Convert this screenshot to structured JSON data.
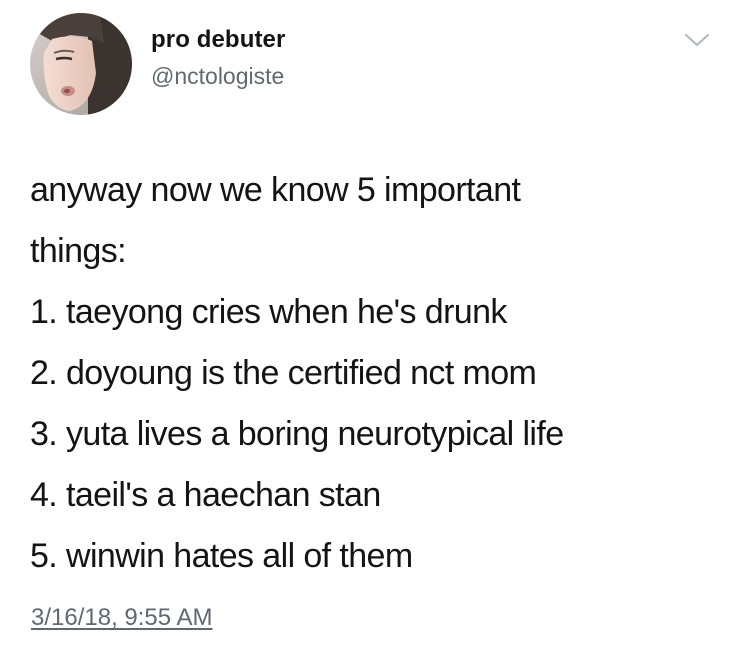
{
  "author": {
    "display_name": "pro debuter",
    "handle": "@nctologiste"
  },
  "menu": {
    "icon": "chevron-down-icon"
  },
  "tweet": {
    "lines": [
      "anyway now we know 5 important",
      "things:",
      "1. taeyong cries when he's drunk",
      "2. doyoung is the certified nct mom",
      "3. yuta lives a boring neurotypical life",
      "4. taeil's a haechan stan",
      "5. winwin hates all of them"
    ],
    "timestamp": "3/16/18, 9:55 AM"
  },
  "colors": {
    "text": "#141414",
    "secondary_text": "#606970",
    "chevron": "#aab8c2",
    "background": "#ffffff"
  }
}
